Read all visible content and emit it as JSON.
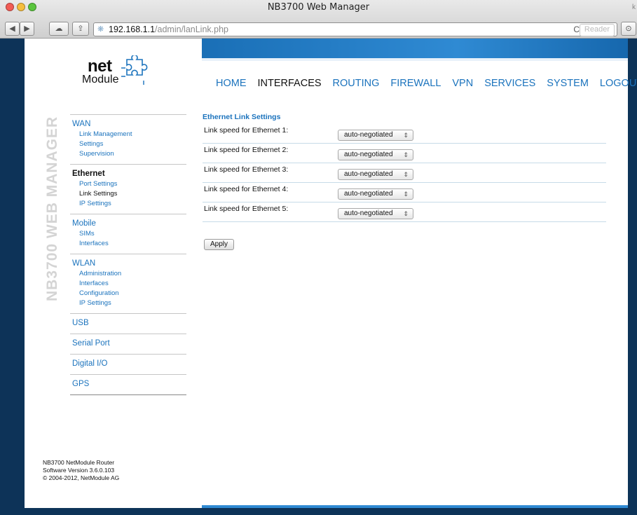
{
  "window": {
    "title": "NB3700 Web Manager",
    "title_right": "k"
  },
  "toolbar": {
    "back_icon": "◀",
    "forward_icon": "▶",
    "cloud_icon": "☁",
    "share_icon": "⇪",
    "url_host": "192.168.1.1",
    "url_path": "/admin/lanLink.php",
    "reload_icon": "C",
    "reader_label": "Reader",
    "download_icon": "⊙"
  },
  "brand": {
    "logo_top": "net",
    "logo_bottom": "Module",
    "vertical": "NB3700 WEB MANAGER"
  },
  "nav": [
    "HOME",
    "INTERFACES",
    "ROUTING",
    "FIREWALL",
    "VPN",
    "SERVICES",
    "SYSTEM",
    "LOGOUT"
  ],
  "sidebar": {
    "wan": {
      "label": "WAN",
      "items": [
        "Link Management",
        "Settings",
        "Supervision"
      ]
    },
    "ethernet": {
      "label": "Ethernet",
      "items": [
        "Port Settings",
        "Link Settings",
        "IP Settings"
      ]
    },
    "mobile": {
      "label": "Mobile",
      "items": [
        "SIMs",
        "Interfaces"
      ]
    },
    "wlan": {
      "label": "WLAN",
      "items": [
        "Administration",
        "Interfaces",
        "Configuration",
        "IP Settings"
      ]
    },
    "usb": "USB",
    "serial": "Serial Port",
    "digital": "Digital I/O",
    "gps": "GPS"
  },
  "content": {
    "title": "Ethernet Link Settings",
    "rows": [
      {
        "label": "Link speed for Ethernet 1:",
        "value": "auto-negotiated"
      },
      {
        "label": "Link speed for Ethernet 2:",
        "value": "auto-negotiated"
      },
      {
        "label": "Link speed for Ethernet 3:",
        "value": "auto-negotiated"
      },
      {
        "label": "Link speed for Ethernet 4:",
        "value": "auto-negotiated"
      },
      {
        "label": "Link speed for Ethernet 5:",
        "value": "auto-negotiated"
      }
    ],
    "select_arrows": "⇕",
    "apply_label": "Apply"
  },
  "footer": {
    "line1": "NB3700 NetModule Router",
    "line2": "Software Version 3.6.0.103",
    "line3": "© 2004-2012, NetModule AG"
  }
}
